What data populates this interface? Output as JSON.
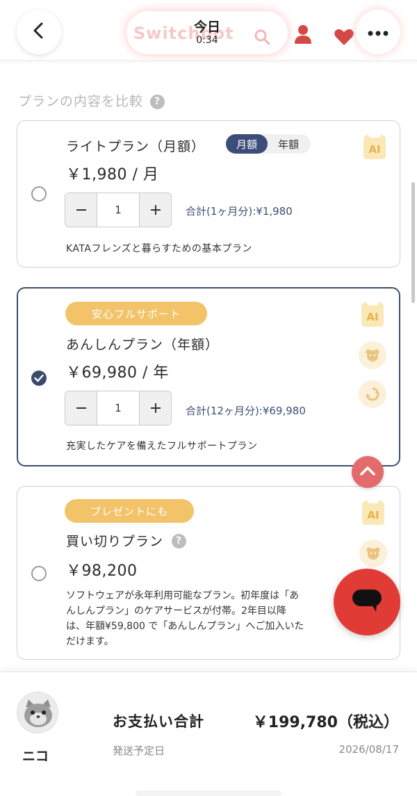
{
  "header": {
    "today_label": "今日",
    "today_time": "0:34",
    "brand_watermark": "Switchbot"
  },
  "section": {
    "title": "プランの内容を比較",
    "help_label": "?"
  },
  "plans": [
    {
      "name": "ライトプラン（月額）",
      "price": "￥1,980 / 月",
      "toggle": {
        "monthly": "月額",
        "yearly": "年額",
        "selected": "monthly"
      },
      "quantity": "1",
      "subtotal": "合計(1ヶ月分):¥1,980",
      "description": "KATAフレンズと暮らすための基本プラン",
      "selected": false,
      "ai_label": "AI"
    },
    {
      "badge": "安心フルサポート",
      "name": "あんしんプラン（年額）",
      "price": "￥69,980 / 年",
      "quantity": "1",
      "subtotal": "合計(12ヶ月分):¥69,980",
      "description": "充実したケアを備えたフルサポートプラン",
      "selected": true,
      "ai_label": "AI"
    },
    {
      "badge": "プレゼントにも",
      "name": "買い切りプラン",
      "help_label": "?",
      "price": "￥98,200",
      "description_lines": [
        "ソフトウェアが永年利用可能なプラン。初年度は「あ",
        "んしんプラン」のケアサービスが付帯。2年目以降",
        "は、年額¥59,800 で「あんしんプラン」へご加入いた",
        "だけます。"
      ],
      "selected": false,
      "ai_label": "AI"
    }
  ],
  "footer": {
    "avatar_name": "ニコ",
    "payment_label": "お支払い合計",
    "payment_total": "￥199,780（税込）",
    "shipping_label": "発送予定日",
    "shipping_date": "2026/08/17"
  },
  "colors": {
    "navy": "#3b4d6e",
    "badge_gold": "#f2c369",
    "accent_red": "#e13b36",
    "ai_cream": "#fbe8b7"
  },
  "icons": [
    "back-arrow-icon",
    "search-icon",
    "user-icon",
    "heart-icon",
    "more-icon",
    "ai-icon",
    "bear-face-icon",
    "recycle-icon",
    "chevron-up-icon",
    "chat-bubble-icon"
  ]
}
